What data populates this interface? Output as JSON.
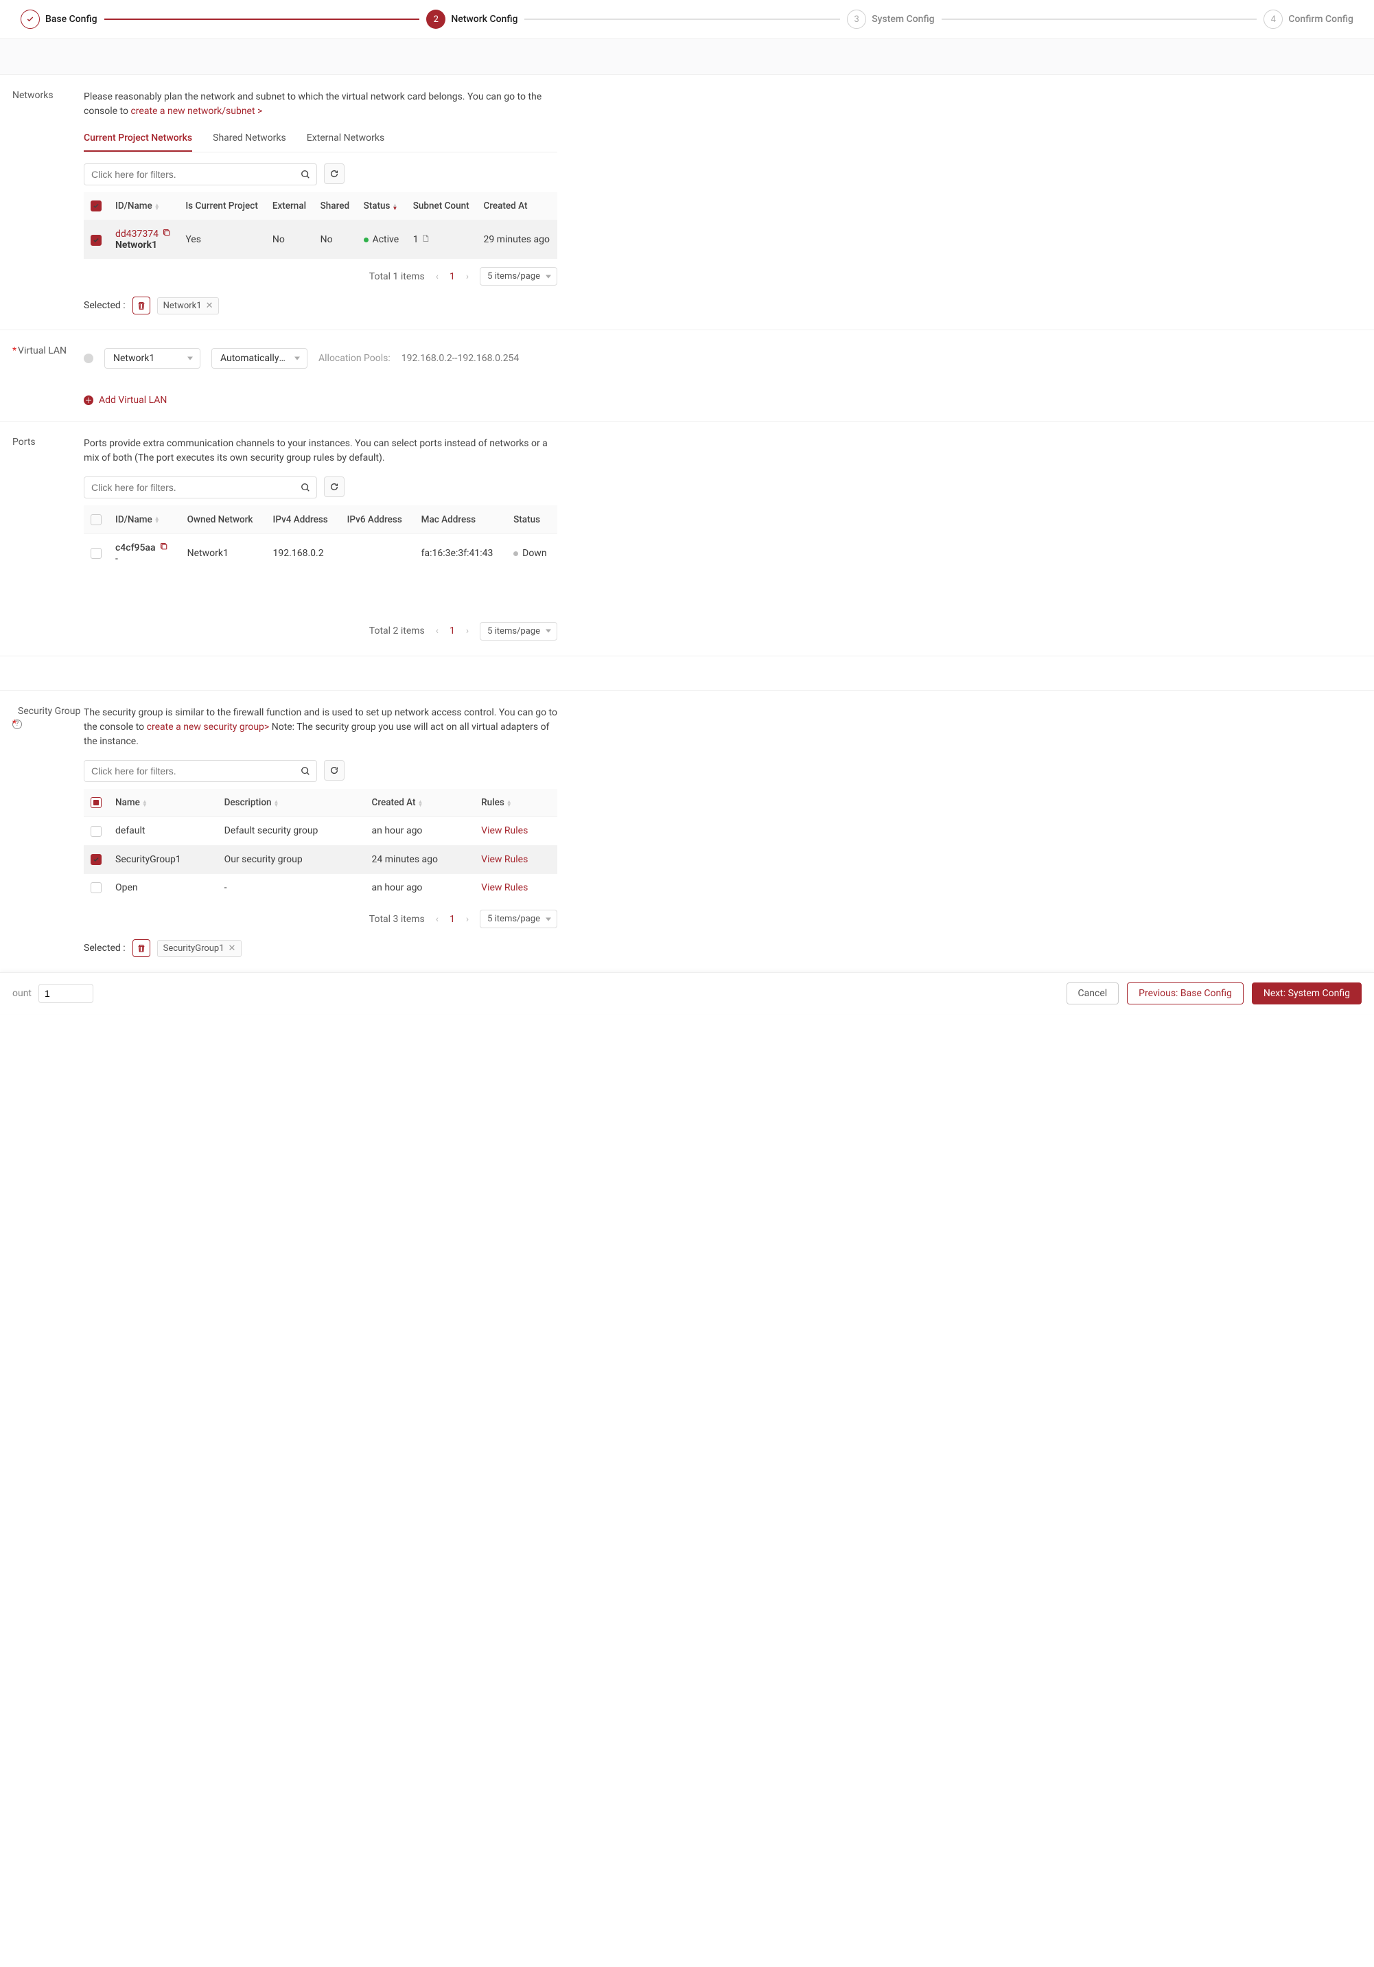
{
  "steps": {
    "s1": "Base Config",
    "s2": "Network Config",
    "s3": "System Config",
    "s4": "Confirm Config",
    "n2": "2",
    "n3": "3",
    "n4": "4"
  },
  "networks": {
    "label": "Networks",
    "desc": "Please reasonably plan the network and subnet to which the virtual network card belongs. You can go to the console to ",
    "link": "create a new network/subnet >",
    "tabs": {
      "current": "Current Project Networks",
      "shared": "Shared Networks",
      "external": "External Networks"
    },
    "filter_placeholder": "Click here for filters.",
    "cols": {
      "id": "ID/Name",
      "proj": "Is Current Project",
      "ext": "External",
      "shared": "Shared",
      "status": "Status",
      "subnet": "Subnet Count",
      "created": "Created At"
    },
    "row": {
      "id": "dd437374",
      "name": "Network1",
      "proj": "Yes",
      "ext": "No",
      "shared": "No",
      "status": "Active",
      "subnet": "1",
      "created": "29 minutes ago"
    },
    "total": "Total 1 items",
    "page": "1",
    "page_size": "5 items/page",
    "selected_label": "Selected :",
    "selected_tag": "Network1"
  },
  "vlan": {
    "label": "Virtual LAN",
    "net_sel": "Network1",
    "subnet_sel": "Automatically Assi…",
    "alloc_label": "Allocation Pools:",
    "alloc_val": "192.168.0.2--192.168.0.254",
    "add": "Add Virtual LAN"
  },
  "ports": {
    "label": "Ports",
    "desc": "Ports provide extra communication channels to your instances. You can select ports instead of networks or a mix of both (The port executes its own security group rules by default).",
    "filter_placeholder": "Click here for filters.",
    "cols": {
      "id": "ID/Name",
      "net": "Owned Network",
      "v4": "IPv4 Address",
      "v6": "IPv6 Address",
      "mac": "Mac Address",
      "status": "Status"
    },
    "row": {
      "id": "c4cf95aa",
      "name": "-",
      "net": "Network1",
      "v4": "192.168.0.2",
      "mac": "fa:16:3e:3f:41:43",
      "status": "Down"
    },
    "total": "Total 2 items",
    "page": "1",
    "page_size": "5 items/page"
  },
  "sg": {
    "label": "Security Group",
    "desc1": "The security group is similar to the firewall function and is used to set up network access control. You can go to the console to ",
    "link": "create a new security group>",
    "desc2": " Note: The security group you use will act on all virtual adapters of the instance.",
    "filter_placeholder": "Click here for filters.",
    "cols": {
      "name": "Name",
      "desc": "Description",
      "created": "Created At",
      "rules": "Rules"
    },
    "rows": {
      "r1": {
        "name": "default",
        "desc": "Default security group",
        "created": "an hour ago",
        "rules": "View Rules"
      },
      "r2": {
        "name": "SecurityGroup1",
        "desc": "Our security group",
        "created": "24 minutes ago",
        "rules": "View Rules"
      },
      "r3": {
        "name": "Open",
        "desc": "-",
        "created": "an hour ago",
        "rules": "View Rules"
      }
    },
    "total": "Total 3 items",
    "page": "1",
    "page_size": "5 items/page",
    "selected_label": "Selected :",
    "selected_tag": "SecurityGroup1"
  },
  "footer": {
    "count_label": "ount",
    "count_val": "1",
    "cancel": "Cancel",
    "prev": "Previous: Base Config",
    "next": "Next: System Config"
  }
}
